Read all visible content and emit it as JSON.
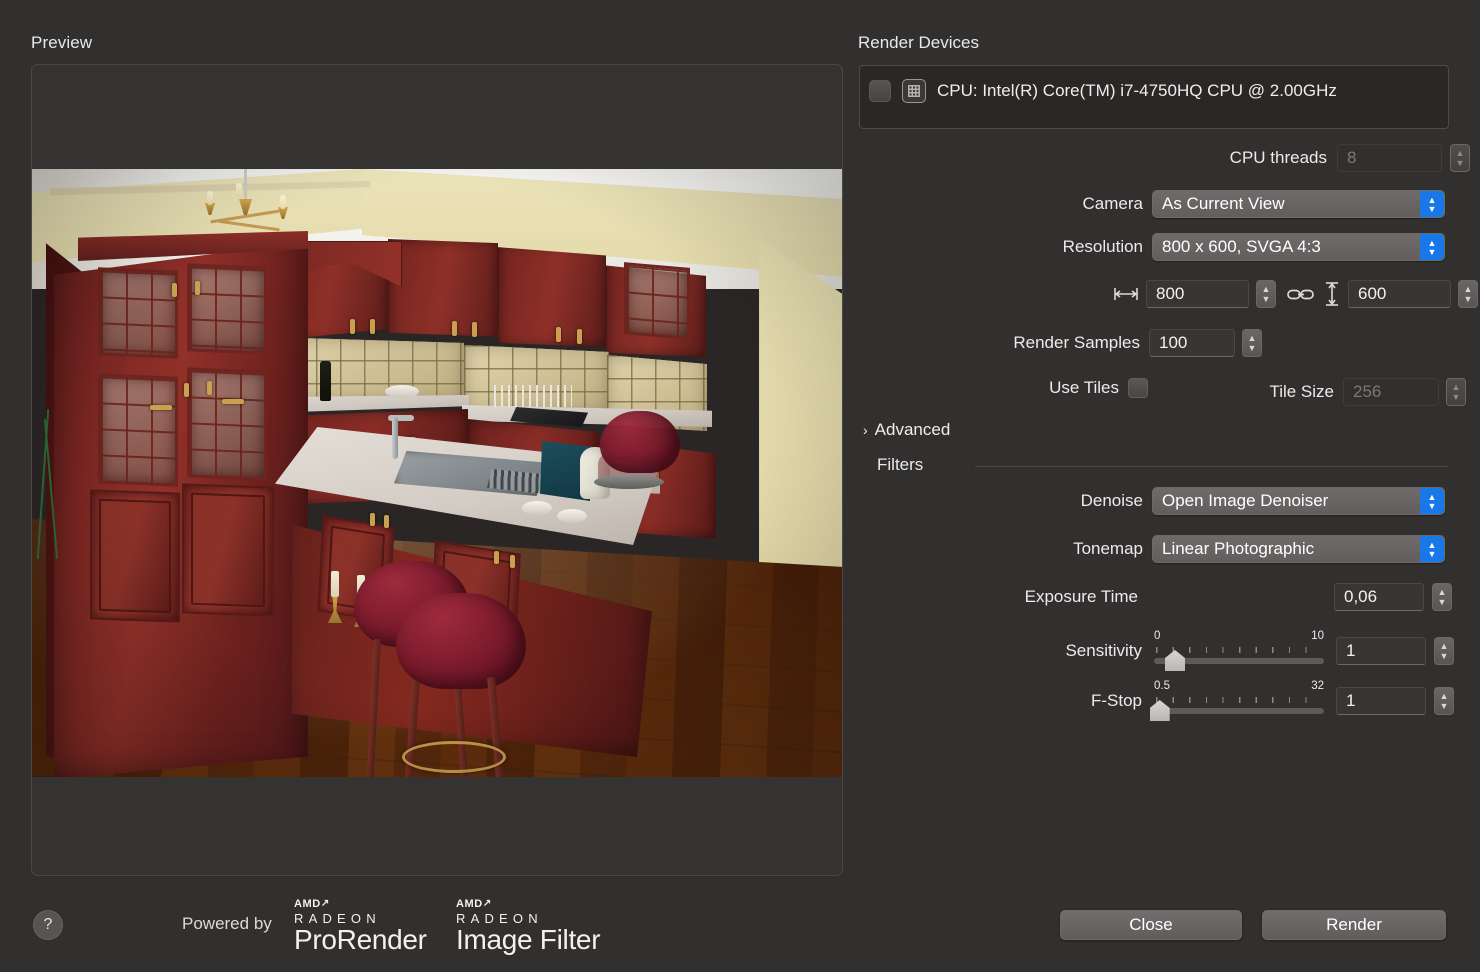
{
  "preview": {
    "label": "Preview",
    "image_alt": "3D rendered kitchen interior with dark cherry wood cabinets, marble island, red bar stools and wood floor"
  },
  "footer": {
    "help_icon": "question-mark-icon",
    "powered_by": "Powered by",
    "logos": [
      {
        "brand": "AMD",
        "arrow": "↗",
        "line": "RADEON",
        "product": "ProRender"
      },
      {
        "brand": "AMD",
        "arrow": "↗",
        "line": "RADEON",
        "product": "Image Filter"
      }
    ],
    "close_label": "Close",
    "render_label": "Render"
  },
  "render_devices": {
    "title": "Render Devices",
    "devices": [
      {
        "checked": false,
        "icon": "cpu-chip-icon",
        "name": "CPU: Intel(R) Core(TM) i7-4750HQ CPU @ 2.00GHz"
      }
    ]
  },
  "settings": {
    "cpu_threads": {
      "label": "CPU threads",
      "value": "8",
      "disabled": true
    },
    "camera": {
      "label": "Camera",
      "value": "As Current View"
    },
    "resolution": {
      "label": "Resolution",
      "value": "800 x 600, SVGA 4:3"
    },
    "width": {
      "icon": "horizontal-arrows-icon",
      "value": "800"
    },
    "link": {
      "icon": "link-chain-icon"
    },
    "height": {
      "icon": "vertical-arrows-icon",
      "value": "600"
    },
    "render_samples": {
      "label": "Render Samples",
      "value": "100"
    },
    "use_tiles": {
      "label": "Use Tiles",
      "checked": false
    },
    "tile_size": {
      "label": "Tile Size",
      "value": "256",
      "disabled": true
    },
    "advanced": {
      "label": "Advanced",
      "expanded": false,
      "icon": "chevron-right-icon"
    }
  },
  "filters": {
    "title": "Filters",
    "denoise": {
      "label": "Denoise",
      "value": "Open Image Denoiser"
    },
    "tonemap": {
      "label": "Tonemap",
      "value": "Linear Photographic"
    },
    "exposure_time": {
      "label": "Exposure Time",
      "value": "0,06"
    },
    "sensitivity": {
      "label": "Sensitivity",
      "min": "0",
      "max": "10",
      "value": "1",
      "position_pct": 10
    },
    "fstop": {
      "label": "F-Stop",
      "min": "0.5",
      "max": "32",
      "value": "1",
      "position_pct": 1
    }
  },
  "colors": {
    "window_bg": "#322f2f",
    "accent_blue": "#1878e8",
    "panel_bg": "#353232",
    "field_bg": "#383535"
  }
}
